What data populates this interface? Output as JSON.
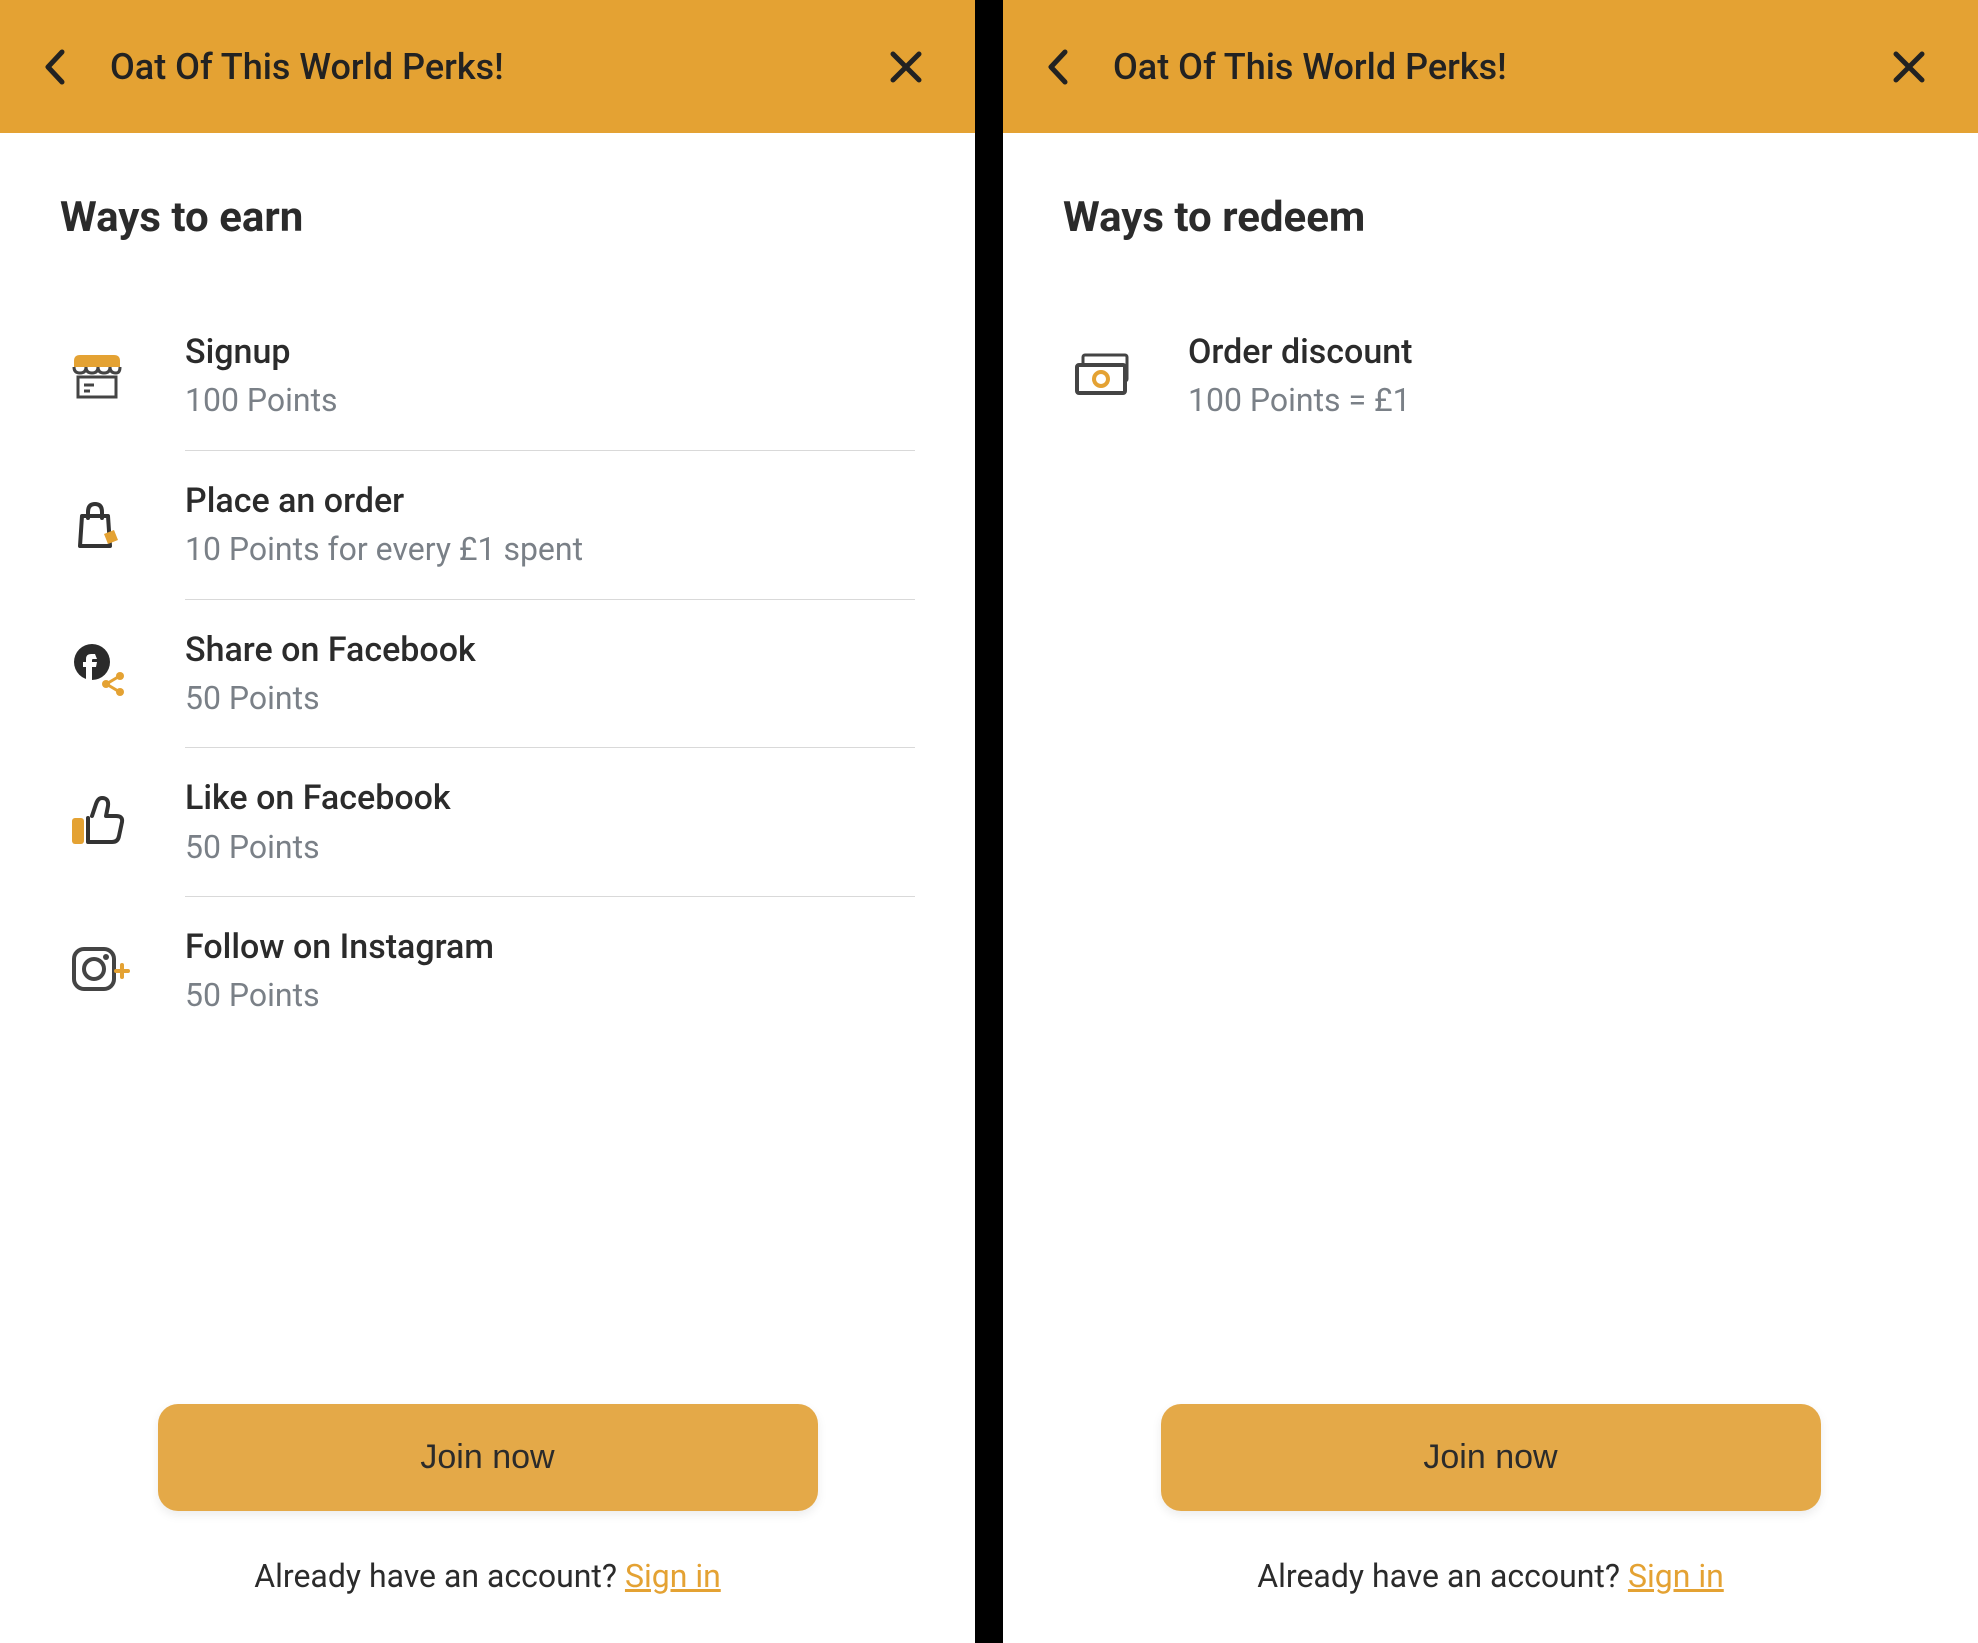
{
  "left": {
    "header_title": "Oat Of This World Perks!",
    "section_title": "Ways to earn",
    "items": [
      {
        "title": "Signup",
        "sub": "100 Points"
      },
      {
        "title": "Place an order",
        "sub": "10 Points for every £1 spent"
      },
      {
        "title": "Share on Facebook",
        "sub": "50 Points"
      },
      {
        "title": "Like on Facebook",
        "sub": "50 Points"
      },
      {
        "title": "Follow on Instagram",
        "sub": "50 Points"
      }
    ],
    "join_label": "Join now",
    "account_prompt": "Already have an account? ",
    "signin_label": "Sign in"
  },
  "right": {
    "header_title": "Oat Of This World Perks!",
    "section_title": "Ways to redeem",
    "items": [
      {
        "title": "Order discount",
        "sub": "100 Points = £1"
      }
    ],
    "join_label": "Join now",
    "account_prompt": "Already have an account? ",
    "signin_label": "Sign in"
  }
}
